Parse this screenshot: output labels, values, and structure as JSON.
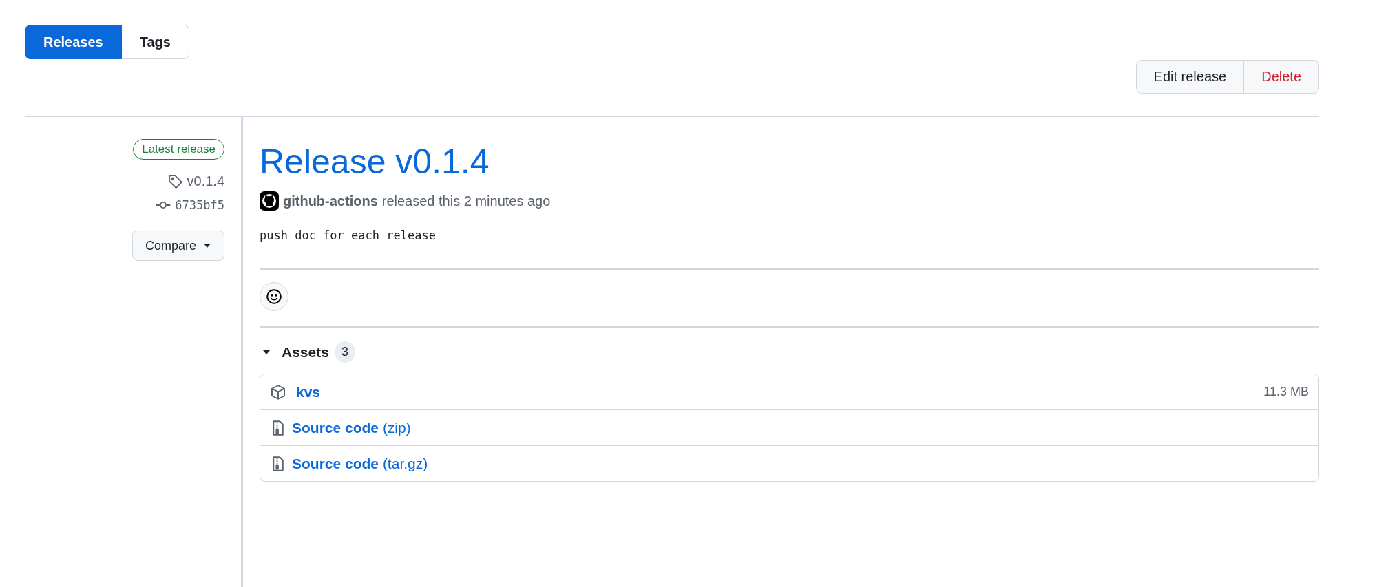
{
  "tabs": [
    {
      "label": "Releases",
      "selected": true
    },
    {
      "label": "Tags",
      "selected": false
    }
  ],
  "actions": [
    {
      "label": "Edit release",
      "kind": "default"
    },
    {
      "label": "Delete",
      "kind": "danger"
    }
  ],
  "sidebar": {
    "badge": "Latest release",
    "tag": "v0.1.4",
    "commit": "6735bf5",
    "compare": "Compare"
  },
  "release": {
    "title": "Release v0.1.4",
    "author": "github-actions",
    "released": "released this 2 minutes ago",
    "body": "push doc for each release"
  },
  "assets": {
    "label": "Assets",
    "count": "3",
    "expanded": true,
    "items": [
      {
        "kind": "package",
        "name": "**kvs**",
        "size": "11.3 MB"
      },
      {
        "kind": "archive",
        "name": "**Source code** (zip)"
      },
      {
        "kind": "archive",
        "name": "**Source code** (tar.gz)"
      }
    ]
  }
}
